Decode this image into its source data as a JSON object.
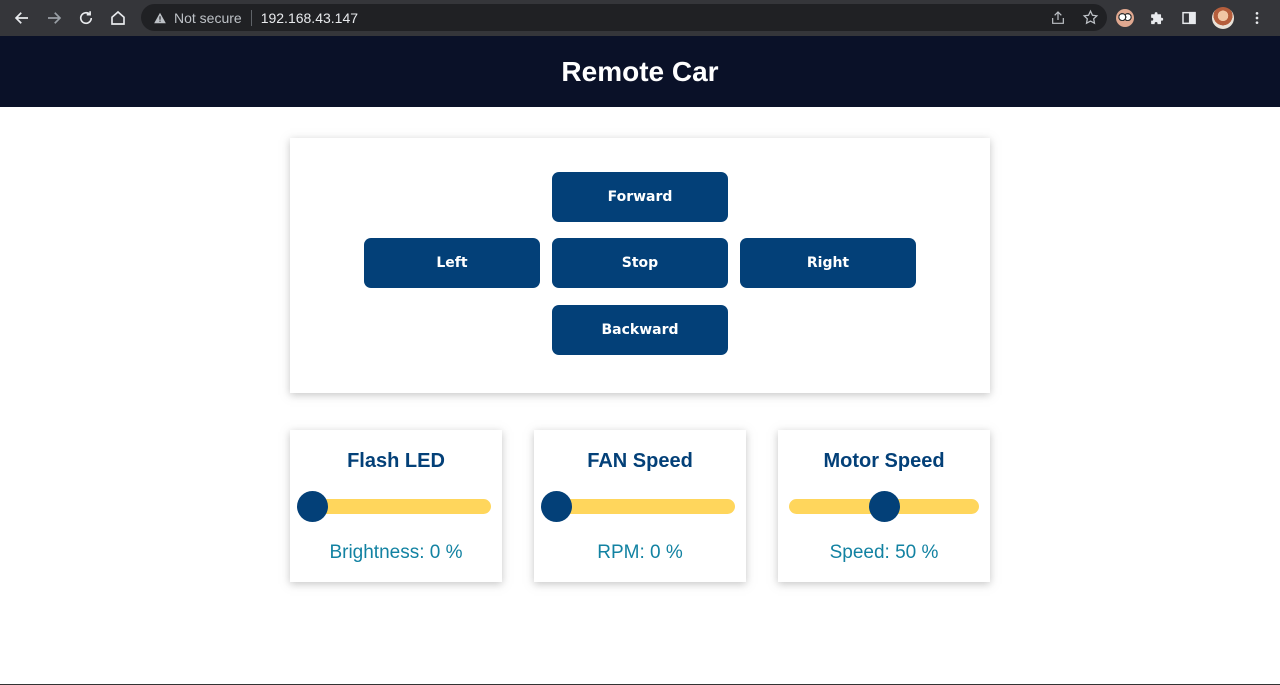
{
  "browser": {
    "security_label": "Not secure",
    "url": "192.168.43.147"
  },
  "header": {
    "title": "Remote Car"
  },
  "controls": {
    "forward_label": "Forward",
    "left_label": "Left",
    "stop_label": "Stop",
    "right_label": "Right",
    "backward_label": "Backward",
    "button_color": "#034078"
  },
  "sliders": [
    {
      "title": "Flash LED",
      "readout": "Brightness: 0 %",
      "value_percent": 0
    },
    {
      "title": "FAN Speed",
      "readout": "RPM: 0 %",
      "value_percent": 0
    },
    {
      "title": "Motor Speed",
      "readout": "Speed: 50 %",
      "value_percent": 50
    }
  ],
  "colors": {
    "navbar": "#0a1128",
    "accent": "#034078",
    "track": "#ffd65c",
    "readout": "#1282a2"
  }
}
